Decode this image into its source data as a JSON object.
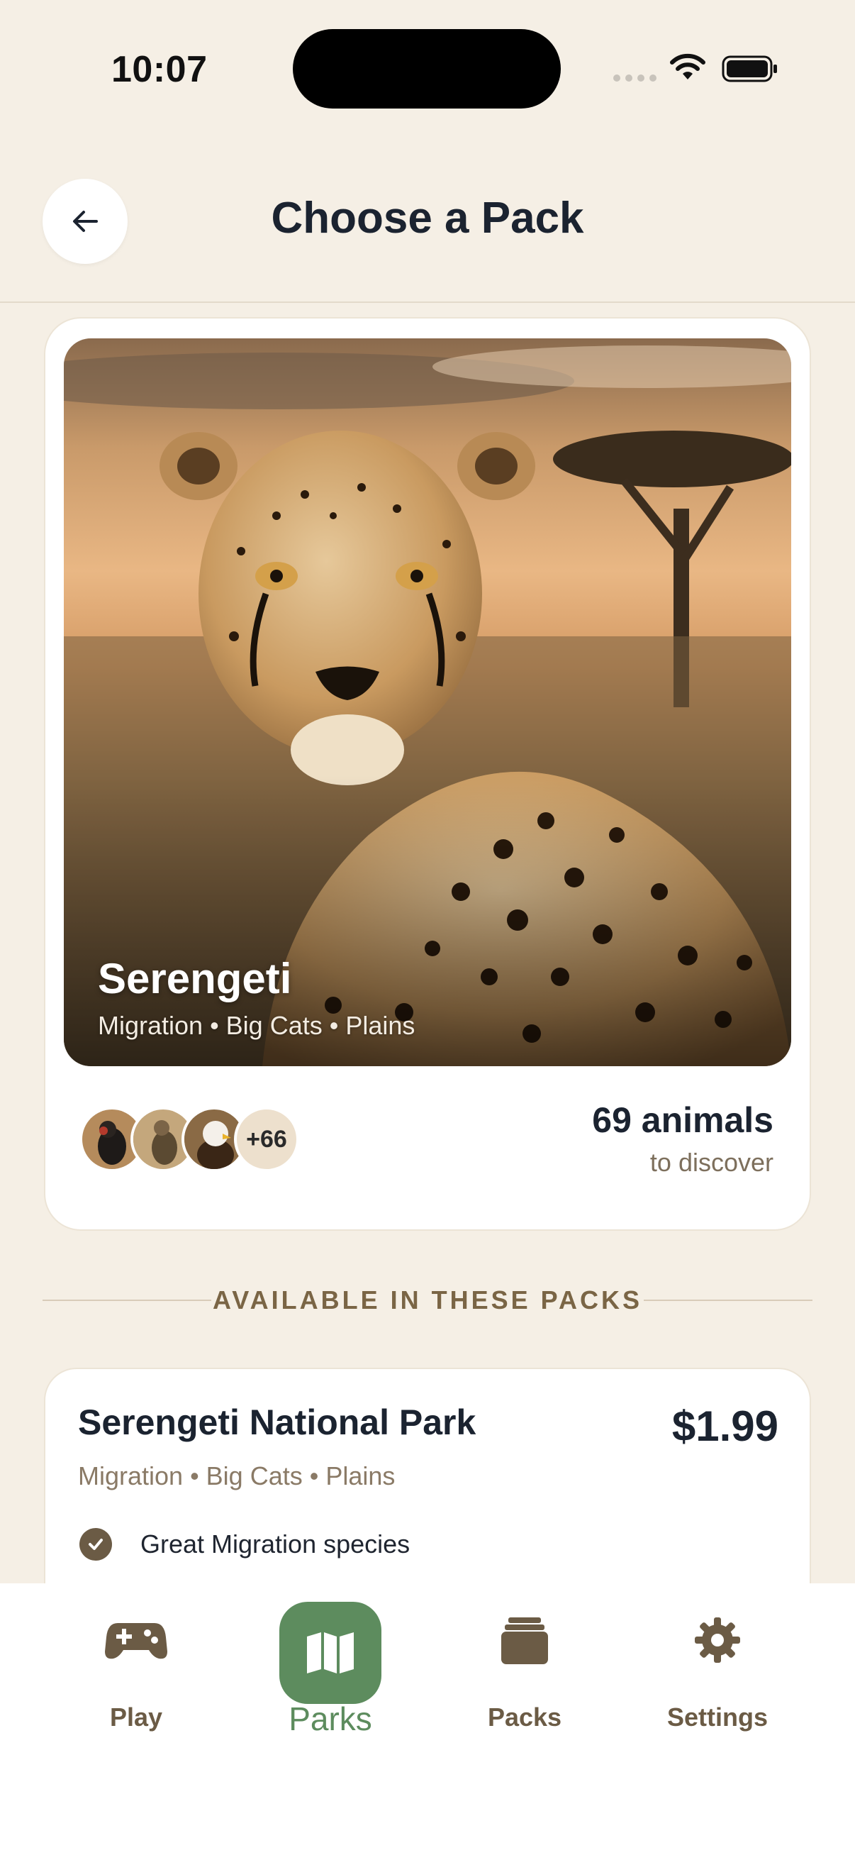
{
  "status": {
    "time": "10:07"
  },
  "header": {
    "title": "Choose a Pack",
    "back_icon": "arrow-left-icon"
  },
  "featured": {
    "title": "Serengeti",
    "subtitle": "Migration • Big Cats • Plains",
    "avatars_more": "+66",
    "animals_count": "69 animals",
    "animals_sub": "to discover"
  },
  "section": {
    "title": "AVAILABLE IN THESE PACKS"
  },
  "pack": {
    "name": "Serengeti National Park",
    "price": "$1.99",
    "tags": "Migration • Big Cats • Plains",
    "feature_1": "Great Migration species"
  },
  "tabs": [
    {
      "label": "Play",
      "icon": "gamepad-icon",
      "active": false
    },
    {
      "label": "Parks",
      "icon": "map-icon",
      "active": true
    },
    {
      "label": "Packs",
      "icon": "stack-icon",
      "active": false
    },
    {
      "label": "Settings",
      "icon": "gear-icon",
      "active": false
    }
  ],
  "colors": {
    "background": "#f5efe5",
    "accent_green": "#5d8c5e",
    "brown": "#6b5b45",
    "text_dark": "#1b2330"
  }
}
